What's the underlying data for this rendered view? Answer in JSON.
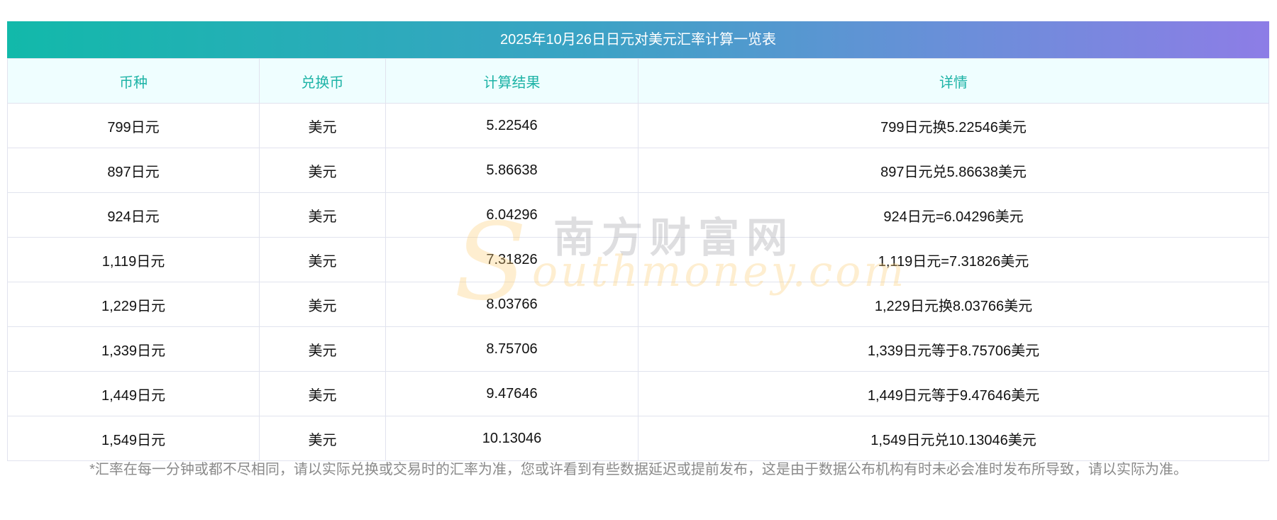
{
  "title": "2025年10月26日日元对美元汇率计算一览表",
  "headers": [
    "币种",
    "兑换币",
    "计算结果",
    "详情"
  ],
  "rows": [
    [
      "799日元",
      "美元",
      "5.22546",
      "799日元换5.22546美元"
    ],
    [
      "897日元",
      "美元",
      "5.86638",
      "897日元兑5.86638美元"
    ],
    [
      "924日元",
      "美元",
      "6.04296",
      "924日元=6.04296美元"
    ],
    [
      "1,119日元",
      "美元",
      "7.31826",
      "1,119日元=7.31826美元"
    ],
    [
      "1,229日元",
      "美元",
      "8.03766",
      "1,229日元换8.03766美元"
    ],
    [
      "1,339日元",
      "美元",
      "8.75706",
      "1,339日元等于8.75706美元"
    ],
    [
      "1,449日元",
      "美元",
      "9.47646",
      "1,449日元等于9.47646美元"
    ],
    [
      "1,549日元",
      "美元",
      "10.13046",
      "1,549日元兑10.13046美元"
    ]
  ],
  "note": "*汇率在每一分钟或都不尽相同，请以实际兑换或交易时的汇率为准，您或许看到有些数据延迟或提前发布，这是由于数据公布机构有时未必会准时发布所导致，请以实际为准。",
  "watermark": {
    "cn": "南方财富网",
    "en": "outhmoney.com",
    "s": "S"
  }
}
